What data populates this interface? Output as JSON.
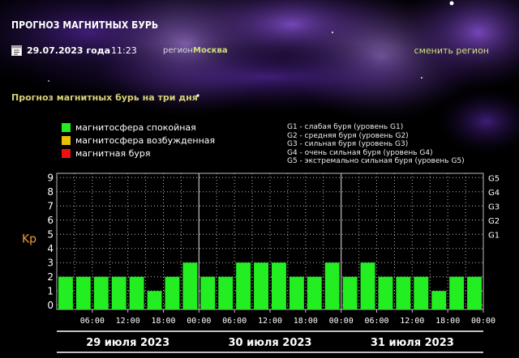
{
  "header": {
    "title": "ПРОГНОЗ МАГНИТНЫХ БУРЬ"
  },
  "info": {
    "date": "29.07.2023 года",
    "time": "11:23",
    "region_label": "регион:",
    "region": "Москва",
    "change_region": "сменить регион"
  },
  "section_title": "Прогноз магнитных бурь на три дня",
  "legend": [
    {
      "label": "магнитосфера спокойная",
      "color": "#22ee22"
    },
    {
      "label": "магнитосфера возбужденная",
      "color": "#e8c000"
    },
    {
      "label": "магнитная буря",
      "color": "#ee1111"
    }
  ],
  "storm_levels": [
    "G1 - слабая буря (уровень G1)",
    "G2 - средняя буря (уровень G2)",
    "G3 - сильная буря (уровень G3)",
    "G4 - очень сильная буря (уровень G4)",
    "G5 - экстремально сильная буря (уровень G5)"
  ],
  "colors": {
    "bar_quiet": "#22ee22",
    "grid": "#bbbbbb",
    "axis_label": "#f0a030",
    "accent_text": "#cfe07a",
    "section_title": "#d8d27a"
  },
  "chart_data": {
    "type": "bar",
    "ylabel": "Kp",
    "ylim": [
      0,
      9
    ],
    "yticks": [
      "0",
      "1",
      "2",
      "3",
      "4",
      "5",
      "6",
      "7",
      "8",
      "9"
    ],
    "right_ticks": [
      {
        "value": 5,
        "label": "G1"
      },
      {
        "value": 6,
        "label": "G2"
      },
      {
        "value": 7,
        "label": "G3"
      },
      {
        "value": 8,
        "label": "G4"
      },
      {
        "value": 9,
        "label": "G5"
      }
    ],
    "x_tick_labels": [
      "06:00",
      "12:00",
      "18:00",
      "00:00",
      "06:00",
      "12:00",
      "18:00",
      "00:00",
      "06:00",
      "12:00",
      "18:00",
      "00:00"
    ],
    "days": [
      "29 июля 2023",
      "30 июля 2023",
      "31 июля 2023"
    ],
    "values": [
      2,
      2,
      2,
      2,
      2,
      1,
      2,
      3,
      2,
      2,
      3,
      3,
      3,
      2,
      2,
      3,
      2,
      3,
      2,
      2,
      2,
      1,
      2,
      2
    ],
    "grid": true
  }
}
